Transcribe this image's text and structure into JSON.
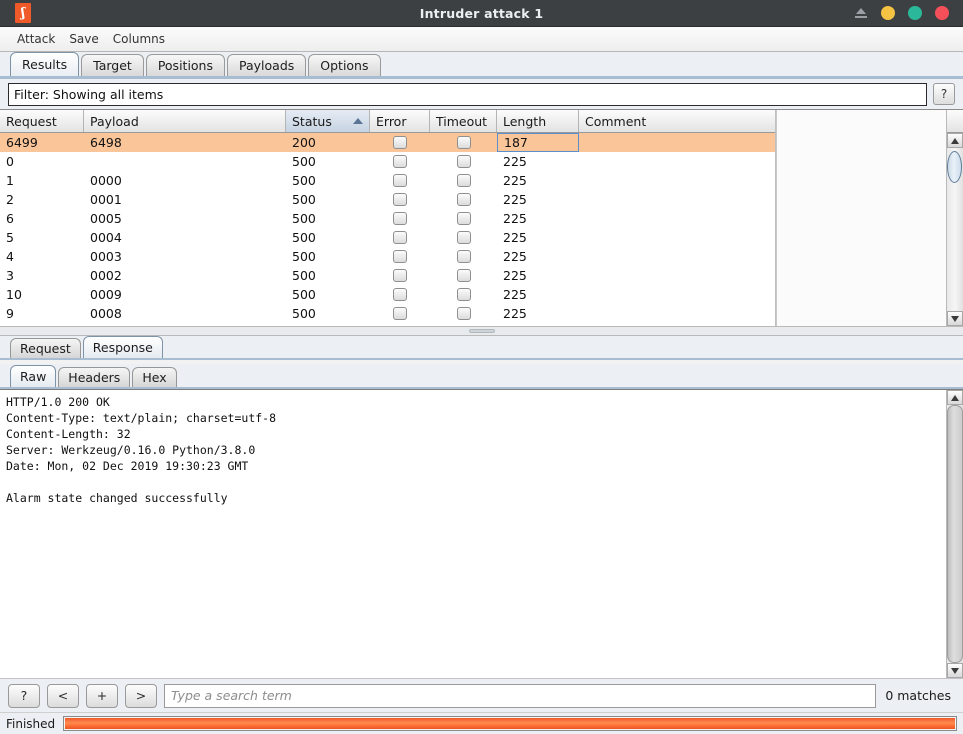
{
  "window": {
    "title": "Intruder attack 1",
    "logo_icon": "burp-suite-logo",
    "controls": {
      "shade_icon": "window-shade-icon",
      "minimize_icon": "minimize-icon",
      "maximize_icon": "maximize-icon",
      "close_icon": "close-icon"
    },
    "colors": {
      "titlebar": "#3c4043",
      "logo_orange": "#f05a28",
      "minimize": "#f5c343",
      "maximize": "#2bb89a",
      "close": "#f4505a",
      "selected_row": "#fbc59a",
      "progress": "#f05a28"
    }
  },
  "menubar": {
    "items": [
      {
        "label": "Attack"
      },
      {
        "label": "Save"
      },
      {
        "label": "Columns"
      }
    ]
  },
  "tabs": {
    "items": [
      {
        "label": "Results",
        "active": true
      },
      {
        "label": "Target",
        "active": false
      },
      {
        "label": "Positions",
        "active": false
      },
      {
        "label": "Payloads",
        "active": false
      },
      {
        "label": "Options",
        "active": false
      }
    ]
  },
  "filter": {
    "text": "Filter: Showing all items",
    "help_label": "?",
    "help_icon": "question-mark-icon"
  },
  "results_table": {
    "columns": [
      {
        "key": "request",
        "label": "Request",
        "sorted": false
      },
      {
        "key": "payload",
        "label": "Payload",
        "sorted": false
      },
      {
        "key": "status",
        "label": "Status",
        "sorted": true,
        "sort_dir": "asc",
        "sort_icon": "sort-ascending-icon"
      },
      {
        "key": "error",
        "label": "Error",
        "sorted": false
      },
      {
        "key": "timeout",
        "label": "Timeout",
        "sorted": false
      },
      {
        "key": "length",
        "label": "Length",
        "sorted": false
      },
      {
        "key": "comment",
        "label": "Comment",
        "sorted": false
      }
    ],
    "rows": [
      {
        "request": "6499",
        "payload": "6498",
        "status": "200",
        "error": false,
        "timeout": false,
        "length": "187",
        "comment": "",
        "selected": true,
        "focused_cell": "length"
      },
      {
        "request": "0",
        "payload": "",
        "status": "500",
        "error": false,
        "timeout": false,
        "length": "225",
        "comment": "",
        "selected": false
      },
      {
        "request": "1",
        "payload": "0000",
        "status": "500",
        "error": false,
        "timeout": false,
        "length": "225",
        "comment": "",
        "selected": false
      },
      {
        "request": "2",
        "payload": "0001",
        "status": "500",
        "error": false,
        "timeout": false,
        "length": "225",
        "comment": "",
        "selected": false
      },
      {
        "request": "6",
        "payload": "0005",
        "status": "500",
        "error": false,
        "timeout": false,
        "length": "225",
        "comment": "",
        "selected": false
      },
      {
        "request": "5",
        "payload": "0004",
        "status": "500",
        "error": false,
        "timeout": false,
        "length": "225",
        "comment": "",
        "selected": false
      },
      {
        "request": "4",
        "payload": "0003",
        "status": "500",
        "error": false,
        "timeout": false,
        "length": "225",
        "comment": "",
        "selected": false
      },
      {
        "request": "3",
        "payload": "0002",
        "status": "500",
        "error": false,
        "timeout": false,
        "length": "225",
        "comment": "",
        "selected": false
      },
      {
        "request": "10",
        "payload": "0009",
        "status": "500",
        "error": false,
        "timeout": false,
        "length": "225",
        "comment": "",
        "selected": false
      },
      {
        "request": "9",
        "payload": "0008",
        "status": "500",
        "error": false,
        "timeout": false,
        "length": "225",
        "comment": "",
        "selected": false
      }
    ]
  },
  "message_tabs": {
    "items": [
      {
        "label": "Request",
        "active": false
      },
      {
        "label": "Response",
        "active": true
      }
    ]
  },
  "view_tabs": {
    "items": [
      {
        "label": "Raw",
        "active": true
      },
      {
        "label": "Headers",
        "active": false
      },
      {
        "label": "Hex",
        "active": false
      }
    ]
  },
  "response": {
    "body": "HTTP/1.0 200 OK\nContent-Type: text/plain; charset=utf-8\nContent-Length: 32\nServer: Werkzeug/0.16.0 Python/3.8.0\nDate: Mon, 02 Dec 2019 19:30:23 GMT\n\nAlarm state changed successfully"
  },
  "search": {
    "help_label": "?",
    "prev_label": "<",
    "add_label": "+",
    "next_label": ">",
    "placeholder": "Type a search term",
    "value": "",
    "matches": "0 matches"
  },
  "status": {
    "label": "Finished",
    "progress_percent": 100
  }
}
